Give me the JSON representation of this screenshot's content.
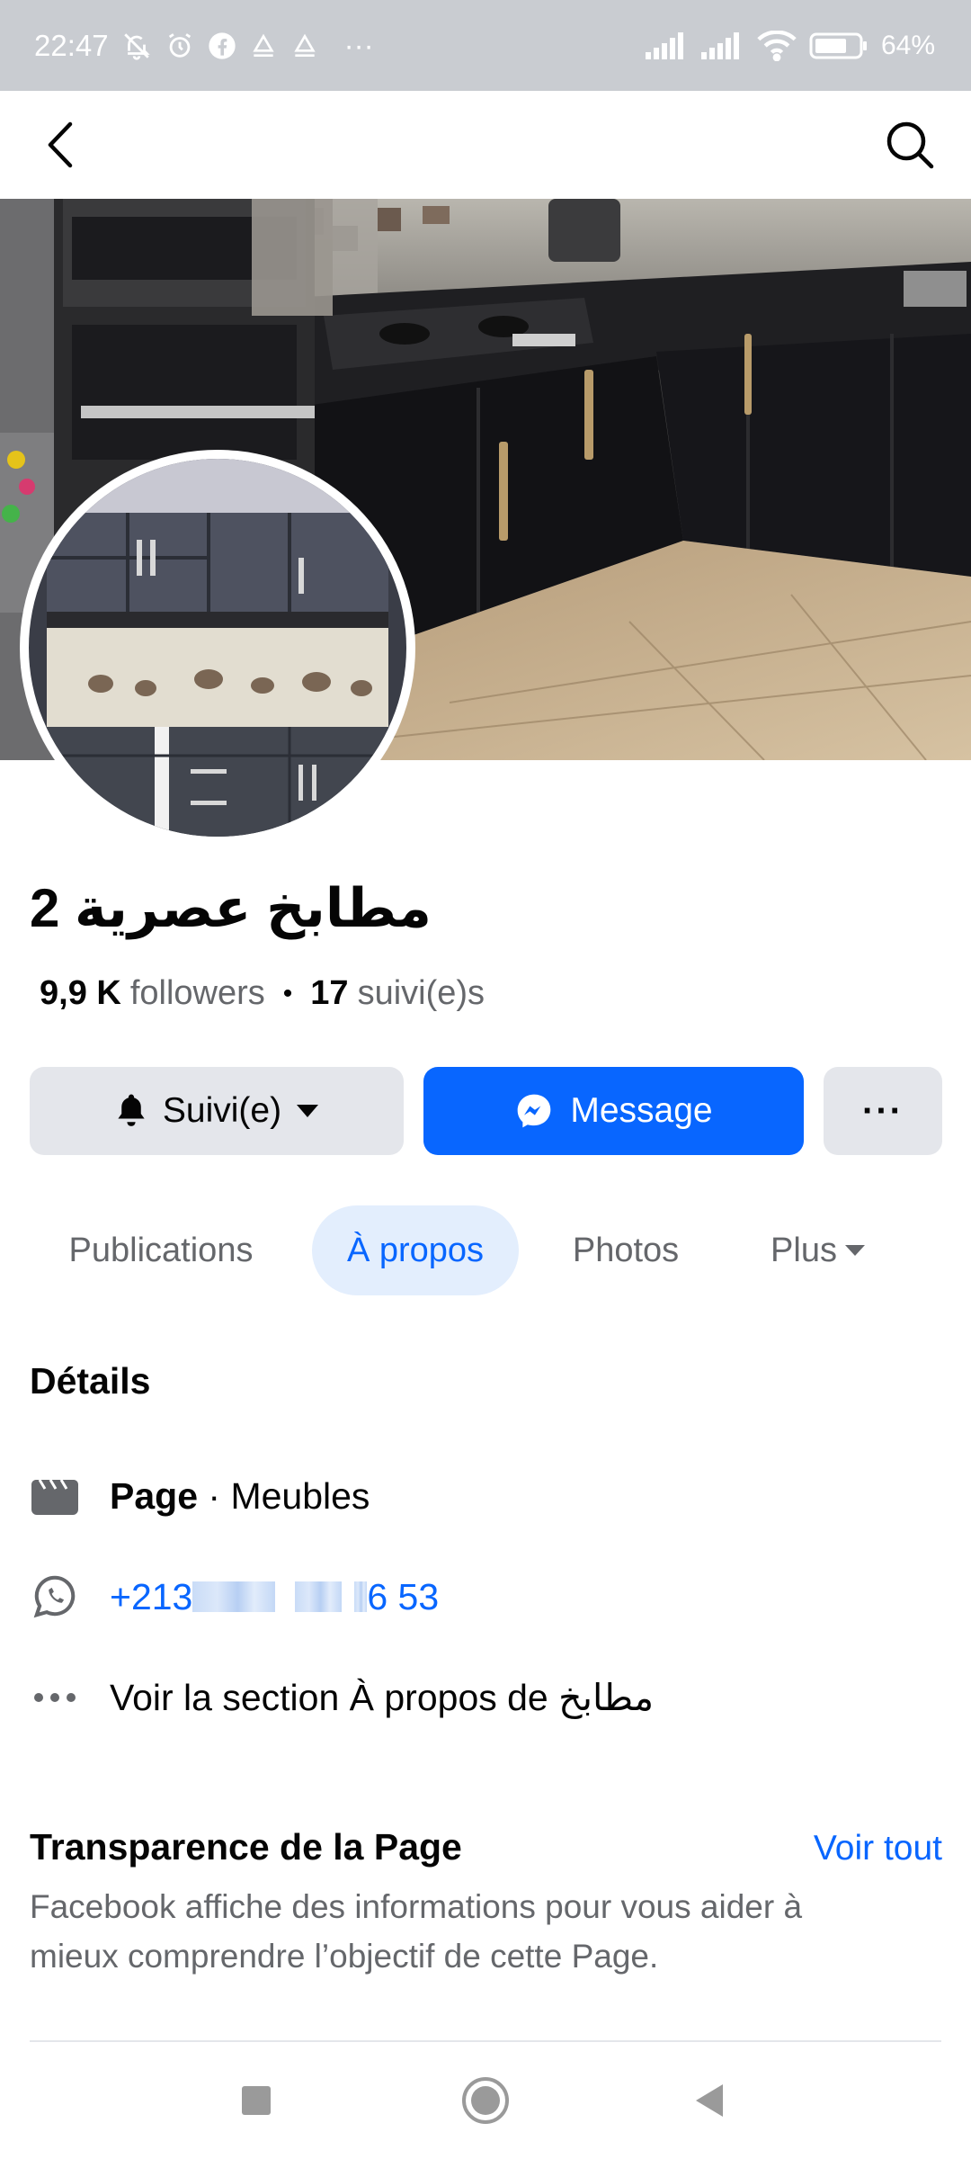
{
  "status_bar": {
    "time": "22:47",
    "extra_indicator": "···",
    "battery": "64%"
  },
  "app_bar": {
    "back_icon": "chevron-left-icon",
    "search_icon": "search-icon"
  },
  "profile": {
    "name": "مطابخ عصرية 2",
    "followers_count": "9,9 K",
    "followers_label": "followers",
    "following_count": "17",
    "following_label": "suivi(e)s"
  },
  "actions": {
    "following_label": "Suivi(e)",
    "message_label": "Message",
    "more_label": "···"
  },
  "tabs": [
    {
      "label": "Publications",
      "active": false
    },
    {
      "label": "À propos",
      "active": true
    },
    {
      "label": "Photos",
      "active": false
    },
    {
      "label": "Plus",
      "active": false
    }
  ],
  "details": {
    "title": "Détails",
    "category_prefix": "Page",
    "category_separator": " · ",
    "category": "Meubles",
    "phone_start": "+213",
    "phone_end": "6 53",
    "about_link": "Voir la section À propos de مطابخ"
  },
  "transparency": {
    "title": "Transparence de la Page",
    "see_all": "Voir tout",
    "description": "Facebook affiche des informations pour vous aider à mieux comprendre l’objectif de cette Page."
  },
  "colors": {
    "accent": "#0866ff",
    "secondary_button": "#e4e6eb",
    "active_tab_bg": "#e3eefd",
    "muted_text": "#65676b",
    "status_bar": "#c9ccd1"
  }
}
